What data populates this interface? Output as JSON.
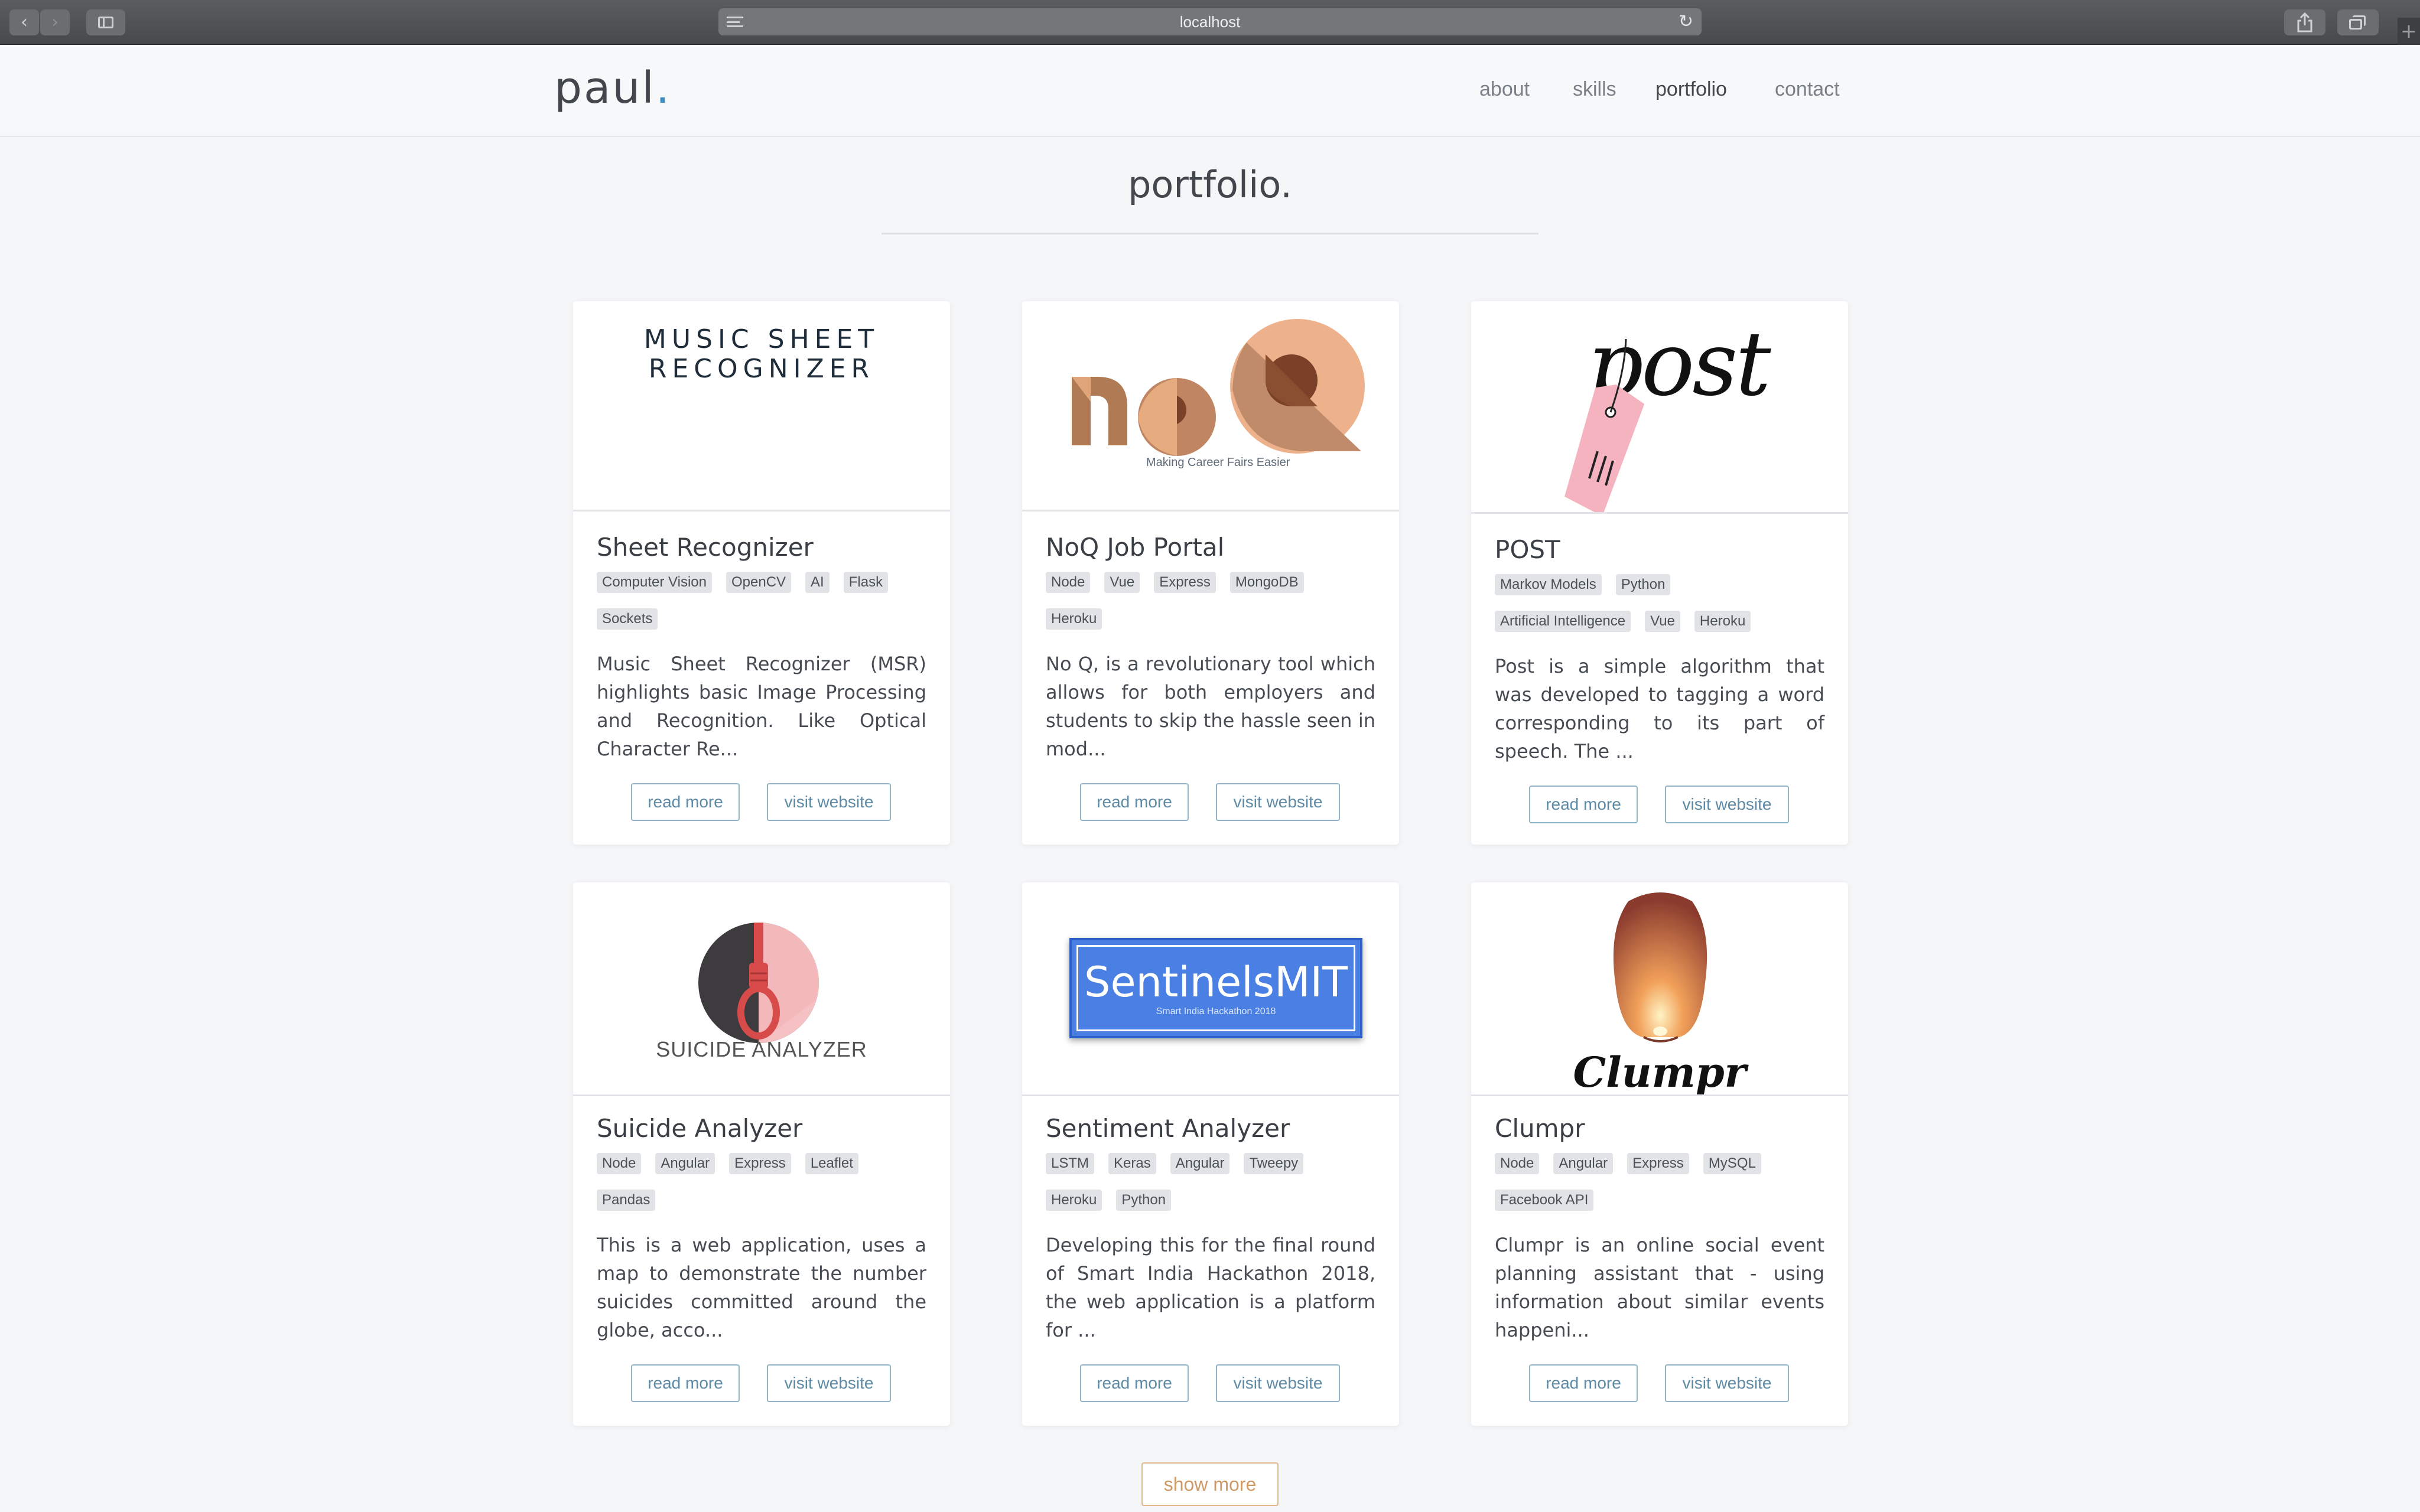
{
  "browser": {
    "url": "localhost",
    "back_icon": "‹",
    "forward_icon": "›",
    "reload_icon": "↻",
    "plus_icon": "+"
  },
  "header": {
    "logo": "paul",
    "logo_dot": ".",
    "nav": [
      "about",
      "skills",
      "portfolio",
      "contact"
    ],
    "active_nav": "portfolio"
  },
  "section": {
    "title": "portfolio."
  },
  "projects": [
    {
      "thumb_text": [
        "MUSIC SHEET",
        "RECOGNIZER"
      ],
      "title": "Sheet Recognizer",
      "tags": [
        "Computer Vision",
        "OpenCV",
        "AI",
        "Flask",
        "Sockets"
      ],
      "description": "Music Sheet Recognizer (MSR) highlights basic Image Processing and Recognition. Like Optical Character Re...",
      "read_more": "read more",
      "visit": "visit website"
    },
    {
      "thumb_text": [
        "Making Career Fairs Easier"
      ],
      "title": "NoQ Job Portal",
      "tags": [
        "Node",
        "Vue",
        "Express",
        "MongoDB",
        "Heroku"
      ],
      "description": "No Q, is a revolutionary tool which allows for both employers and students to skip the hassle seen in mod...",
      "read_more": "read more",
      "visit": "visit website"
    },
    {
      "thumb_text": [
        "post"
      ],
      "title": "POST",
      "tags": [
        "Markov Models",
        "Python",
        "Artificial Intelligence",
        "Vue",
        "Heroku"
      ],
      "description": "Post is a simple algorithm that was developed to tagging a word corresponding to its part of speech. The ...",
      "read_more": "read more",
      "visit": "visit website"
    },
    {
      "thumb_text": [
        "SUICIDE ANALYZER"
      ],
      "title": "Suicide Analyzer",
      "tags": [
        "Node",
        "Angular",
        "Express",
        "Leaflet",
        "Pandas"
      ],
      "description": "This is a web application, uses a map to demonstrate the number suicides committed around the globe, acco...",
      "read_more": "read more",
      "visit": "visit website"
    },
    {
      "thumb_text": [
        "SentinelsMIT",
        "Smart India Hackathon 2018"
      ],
      "title": "Sentiment Analyzer",
      "tags": [
        "LSTM",
        "Keras",
        "Angular",
        "Tweepy",
        "Heroku",
        "Python"
      ],
      "description": "Developing this for the final round of Smart India Hackathon 2018, the web application is a platform for ...",
      "read_more": "read more",
      "visit": "visit website"
    },
    {
      "thumb_text": [
        "Clumpr"
      ],
      "title": "Clumpr",
      "tags": [
        "Node",
        "Angular",
        "Express",
        "MySQL",
        "Facebook API"
      ],
      "description": "Clumpr is an online social event planning assistant that - using information about similar events happeni...",
      "read_more": "read more",
      "visit": "visit website"
    }
  ],
  "show_more": "show more",
  "colors": {
    "accent": "#3d8fc2",
    "button_border": "#8fb2c7",
    "show_more": "#cd9a66"
  }
}
